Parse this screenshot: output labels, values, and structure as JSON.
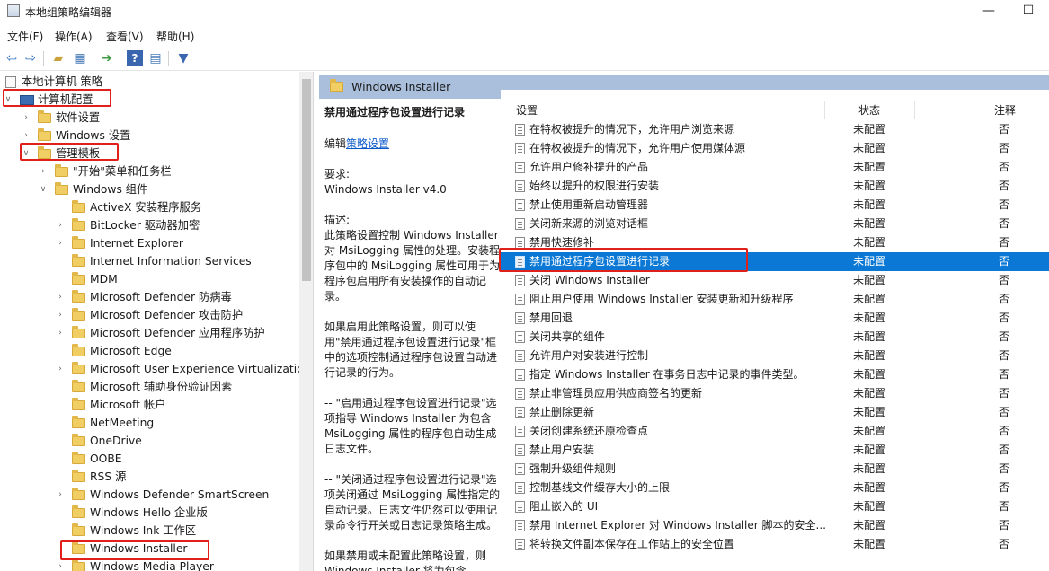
{
  "window": {
    "title": "本地组策略编辑器",
    "minimize": "—",
    "maximize": "☐"
  },
  "menu": [
    "文件(F)",
    "操作(A)",
    "查看(V)",
    "帮助(H)"
  ],
  "toolbar_icons": [
    "back-icon",
    "forward-icon",
    "up-folder-icon",
    "show-hide-tree-icon",
    "export-list-icon",
    "help-icon",
    "properties-icon",
    "filter-icon"
  ],
  "tree": {
    "root": "本地计算机 策略",
    "computer_config": "计算机配置",
    "items": [
      {
        "label": "软件设置"
      },
      {
        "label": "Windows 设置"
      },
      {
        "label": "管理模板"
      },
      {
        "label": "\"开始\"菜单和任务栏"
      },
      {
        "label": "Windows 组件"
      },
      {
        "label": "ActiveX 安装程序服务"
      },
      {
        "label": "BitLocker 驱动器加密"
      },
      {
        "label": "Internet Explorer"
      },
      {
        "label": "Internet Information Services"
      },
      {
        "label": "MDM"
      },
      {
        "label": "Microsoft Defender 防病毒"
      },
      {
        "label": "Microsoft Defender 攻击防护"
      },
      {
        "label": "Microsoft Defender 应用程序防护"
      },
      {
        "label": "Microsoft Edge"
      },
      {
        "label": "Microsoft User Experience Virtualization"
      },
      {
        "label": "Microsoft 辅助身份验证因素"
      },
      {
        "label": "Microsoft 帐户"
      },
      {
        "label": "NetMeeting"
      },
      {
        "label": "OneDrive"
      },
      {
        "label": "OOBE"
      },
      {
        "label": "RSS 源"
      },
      {
        "label": "Windows Defender SmartScreen"
      },
      {
        "label": "Windows Hello 企业版"
      },
      {
        "label": "Windows Ink 工作区"
      },
      {
        "label": "Windows Installer"
      },
      {
        "label": "Windows Media Player"
      }
    ]
  },
  "right_header": "Windows Installer",
  "description": {
    "title": "禁用通过程序包设置进行记录",
    "edit_prefix": "编辑",
    "edit_link": "策略设置",
    "req_label": "要求:",
    "req_value": "Windows Installer v4.0",
    "desc_label": "描述:",
    "p1": "此策略设置控制 Windows Installer 对 MsiLogging 属性的处理。安装程序包中的 MsiLogging 属性可用于为程序包启用所有安装操作的自动记录。",
    "p2": "如果启用此策略设置，则可以使用\"禁用通过程序包设置进行记录\"框中的选项控制通过程序包设置自动进行记录的行为。",
    "p3": "-- \"启用通过程序包设置进行记录\"选项指导 Windows Installer 为包含 MsiLogging 属性的程序包自动生成日志文件。",
    "p4": "-- \"关闭通过程序包设置进行记录\"选项关闭通过 MsiLogging 属性指定的自动记录。日志文件仍然可以使用记录命令行开关或日志记录策略生成。",
    "p5": "如果禁用或未配置此策略设置，则 Windows Installer 将为包含"
  },
  "list": {
    "col_setting": "设置",
    "col_state": "状态",
    "col_note": "注释",
    "rows": [
      {
        "name": "在特权被提升的情况下，允许用户浏览来源",
        "state": "未配置",
        "note": "否"
      },
      {
        "name": "在特权被提升的情况下，允许用户使用媒体源",
        "state": "未配置",
        "note": "否"
      },
      {
        "name": "允许用户修补提升的产品",
        "state": "未配置",
        "note": "否"
      },
      {
        "name": "始终以提升的权限进行安装",
        "state": "未配置",
        "note": "否"
      },
      {
        "name": "禁止使用重新启动管理器",
        "state": "未配置",
        "note": "否"
      },
      {
        "name": "关闭新来源的浏览对话框",
        "state": "未配置",
        "note": "否"
      },
      {
        "name": "禁用快速修补",
        "state": "未配置",
        "note": "否"
      },
      {
        "name": "禁用通过程序包设置进行记录",
        "state": "未配置",
        "note": "否"
      },
      {
        "name": "关闭 Windows Installer",
        "state": "未配置",
        "note": "否"
      },
      {
        "name": "阻止用户使用 Windows Installer 安装更新和升级程序",
        "state": "未配置",
        "note": "否"
      },
      {
        "name": "禁用回退",
        "state": "未配置",
        "note": "否"
      },
      {
        "name": "关闭共享的组件",
        "state": "未配置",
        "note": "否"
      },
      {
        "name": "允许用户对安装进行控制",
        "state": "未配置",
        "note": "否"
      },
      {
        "name": "指定 Windows Installer 在事务日志中记录的事件类型。",
        "state": "未配置",
        "note": "否"
      },
      {
        "name": "禁止非管理员应用供应商签名的更新",
        "state": "未配置",
        "note": "否"
      },
      {
        "name": "禁止删除更新",
        "state": "未配置",
        "note": "否"
      },
      {
        "name": "关闭创建系统还原检查点",
        "state": "未配置",
        "note": "否"
      },
      {
        "name": "禁止用户安装",
        "state": "未配置",
        "note": "否"
      },
      {
        "name": "强制升级组件规则",
        "state": "未配置",
        "note": "否"
      },
      {
        "name": "控制基线文件缓存大小的上限",
        "state": "未配置",
        "note": "否"
      },
      {
        "name": "阻止嵌入的 UI",
        "state": "未配置",
        "note": "否"
      },
      {
        "name": "禁用 Internet Explorer 对 Windows Installer 脚本的安全...",
        "state": "未配置",
        "note": "否"
      },
      {
        "name": "将转换文件副本保存在工作站上的安全位置",
        "state": "未配置",
        "note": "否"
      }
    ]
  },
  "colors": {
    "selection": "#0a78d4",
    "header_band": "#a9bfdc",
    "highlight_box": "#e0201a",
    "link": "#0b59c9"
  }
}
